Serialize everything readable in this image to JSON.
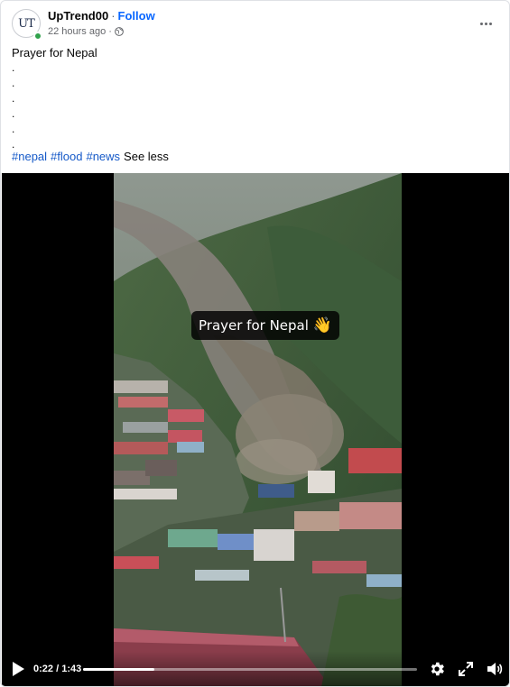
{
  "post": {
    "author": "UpTrend00",
    "avatar_initials": "UT",
    "follow_label": "Follow",
    "timestamp": "22 hours ago",
    "audience_icon": "globe-icon",
    "more_icon": "more-horizontal-icon",
    "text_title": "Prayer for Nepal",
    "text_dots": [
      ".",
      ".",
      ".",
      ".",
      ".",
      "."
    ],
    "hashtags": [
      "#nepal",
      "#flood",
      "#news"
    ],
    "see_less_label": "See less"
  },
  "video": {
    "caption": "Prayer for Nepal",
    "caption_emoji": "👋",
    "current_time": "0:22",
    "duration": "1:43",
    "progress_fraction": 0.213,
    "controls": [
      "play-icon",
      "settings-icon",
      "fullscreen-icon",
      "volume-icon"
    ]
  },
  "colors": {
    "link": "#1559c8",
    "follow": "#0866ff",
    "online": "#31a24c",
    "secondary_text": "#65676b"
  }
}
